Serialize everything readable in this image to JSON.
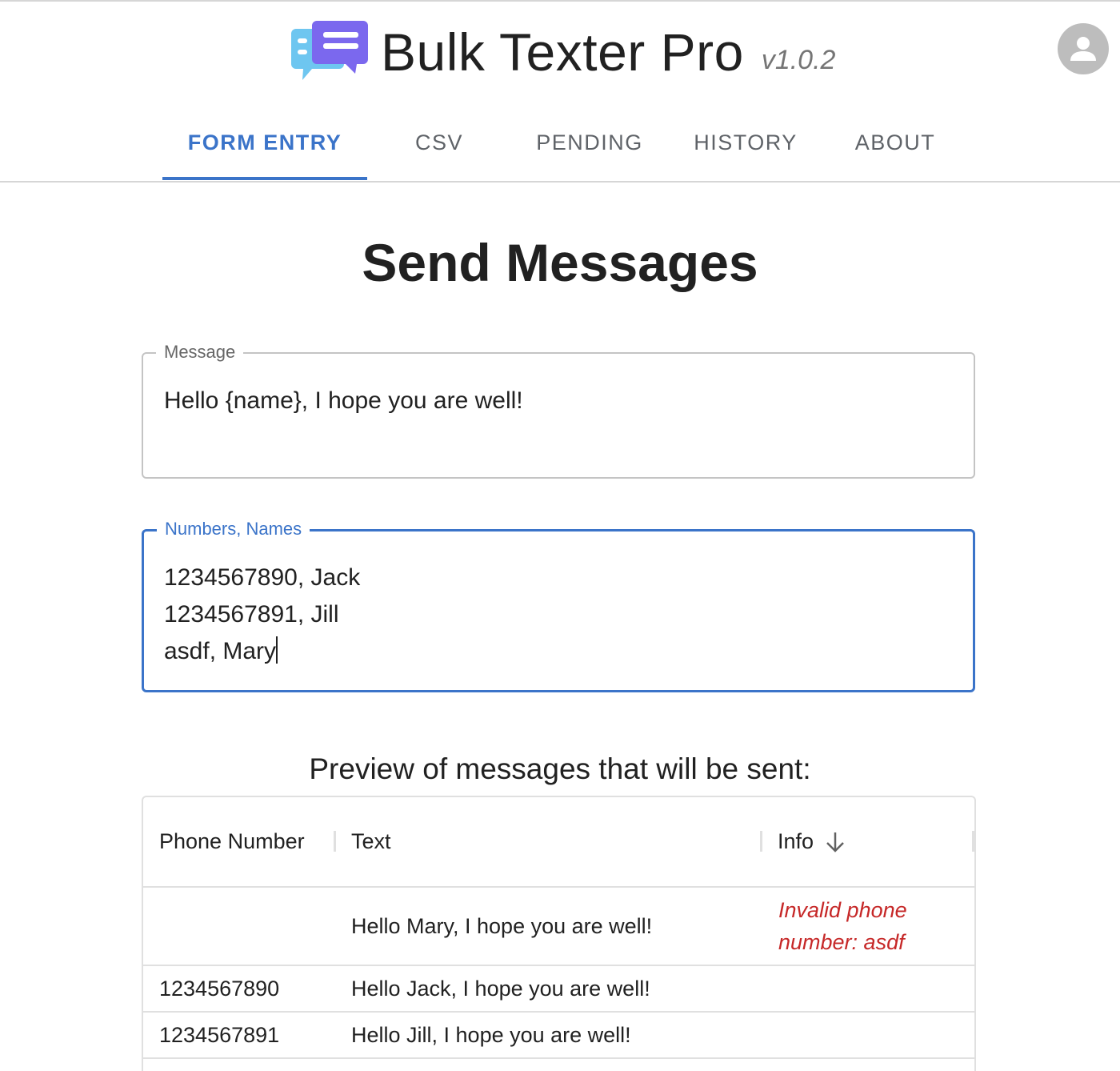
{
  "app": {
    "title": "Bulk Texter Pro",
    "version": "v1.0.2"
  },
  "tabs": [
    {
      "label": "FORM ENTRY",
      "active": true
    },
    {
      "label": "CSV",
      "active": false
    },
    {
      "label": "PENDING",
      "active": false
    },
    {
      "label": "HISTORY",
      "active": false
    },
    {
      "label": "ABOUT",
      "active": false
    }
  ],
  "page": {
    "title": "Send Messages"
  },
  "message_field": {
    "label": "Message",
    "value": "Hello {name}, I hope you are well!"
  },
  "numbers_field": {
    "label": "Numbers, Names",
    "value": "1234567890, Jack\n1234567891, Jill\nasdf, Mary"
  },
  "preview": {
    "title": "Preview of messages that will be sent:",
    "columns": {
      "phone": "Phone Number",
      "text": "Text",
      "info": "Info"
    },
    "rows": [
      {
        "phone": "",
        "text": "Hello Mary, I hope you are well!",
        "info": "Invalid phone number: asdf"
      },
      {
        "phone": "1234567890",
        "text": "Hello Jack, I hope you are well!",
        "info": ""
      },
      {
        "phone": "1234567891",
        "text": "Hello Jill, I hope you are well!",
        "info": ""
      }
    ]
  },
  "colors": {
    "accent": "#3b74c9",
    "error": "#c62828",
    "logo_front": "#7b68ee",
    "logo_back": "#6ec6f0",
    "avatar": "#bdbdbd"
  },
  "icons": {
    "logo": "chat-bubbles-icon",
    "avatar": "account-circle-icon",
    "sort": "arrow-down-icon"
  }
}
